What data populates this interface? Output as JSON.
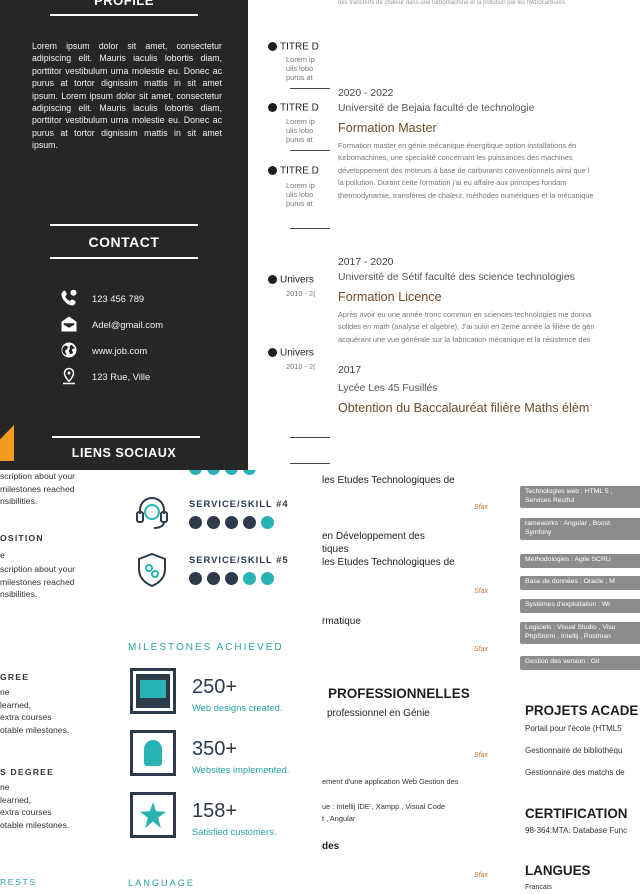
{
  "profile": {
    "heading": "PROFILE",
    "text": "Lorem ipsum dolor sit amet, consectetur adipiscing elit. Mauris iaculis lobortis diam, porttitor vestibulum urna molestie eu. Donec ac purus at tortor dignissim mattis in sit amet ipsum. Lorem ipsum dolor sit amet, consectetur adipiscing elit. Mauris iaculis lobortis diam, porttitor vestibulum urna molestie eu. Donec ac purus at tortor dignissim mattis in sit amet ipsum."
  },
  "contact": {
    "heading": "CONTACT",
    "items": [
      {
        "icon": "phone-icon",
        "text": "123 456 789"
      },
      {
        "icon": "envelope-icon",
        "text": "Adel@gmail.com"
      },
      {
        "icon": "globe-icon",
        "text": "www.job.com"
      },
      {
        "icon": "location-pin-icon",
        "text": "123 Rue, Ville"
      }
    ]
  },
  "social": {
    "heading": "LIENS SOCIAUX"
  },
  "middle": {
    "items": [
      {
        "title": "TITRE D",
        "lines": [
          "Lorem ip",
          "ulis lobo",
          "purus at"
        ]
      },
      {
        "title": "TITRE D",
        "lines": [
          "Lorem ip",
          "ulis lobo",
          "purus at"
        ]
      },
      {
        "title": "TITRE D",
        "lines": [
          "Lorem ip",
          "ulis lobo",
          "purus at"
        ]
      },
      {
        "title": "Univers",
        "lines": [
          "2010 - 2("
        ]
      },
      {
        "title": "Univers",
        "lines": [
          "2010 - 2("
        ]
      }
    ]
  },
  "education": {
    "top_line": "des transferts de chaleur dans une turbomachine et la pollution par les hydrocarbures.",
    "entries": [
      {
        "date": "2020 - 2022",
        "school": "Université de Bejaia faculté de technologie",
        "degree": "Formation Master",
        "desc": "Formation master en génie mécanique énergitique option installations én\nturbomachines, une specialité concernant les puissances des machines\ndéveloppement des moteurs à base de carburants conventionnels ainsi que l\nla pollution. Durant cette formation j'ai eu affaire aux principes fondam\nthermodynamie, transfères de chaleur, méthodes numériques et la mécanique"
      },
      {
        "date": "2017 - 2020",
        "school": "Université de Sétif faculté des science technologies",
        "degree": "Formation Licence",
        "desc": "Après avoir eu une année tronc commun en sciences technologies me donna\nsolides en math (analyse et algèbre), J'ai suivi en 2eme année la filière de gén\nacquérant une vue générale sur la fabrication mécanique et la résistence des"
      },
      {
        "date": "2017",
        "school": "Lycée Les 45 Fusillés",
        "degree": "Obtention du Baccalauréat filière Maths élèm",
        "desc": ""
      }
    ]
  },
  "bottom_left": {
    "block1": "scription about your\nmilestones reached\nnsibilities.",
    "pos_heading": "OSITION",
    "pos_sub": "e",
    "block2": "scription about your\nmilestones reached\nnsibilities.",
    "deg1_heading": "GREE",
    "deg1_lines": "ne\nlearned,\nextra courses\notable milestones.",
    "deg2_heading": "S DEGREE",
    "deg2_lines": "ne\nlearned,\nextra courses\notable milestones.",
    "interests": "RESTS"
  },
  "skills": {
    "items": [
      {
        "label": "SERVICE/SKILL #4",
        "icon": "headset-icon",
        "level": 4
      },
      {
        "label": "SERVICE/SKILL #5",
        "icon": "shield-icon",
        "level": 3
      }
    ],
    "milestones_title": "MILESTONES ACHIEVED",
    "milestones": [
      {
        "icon": "browser-icon",
        "number": "250+",
        "caption": "Web designs created."
      },
      {
        "icon": "touch-icon",
        "number": "350+",
        "caption": "Websites implemented."
      },
      {
        "icon": "star-icon",
        "number": "158+",
        "caption": "Satisfied customers."
      }
    ],
    "language_title": "LANGUAGE",
    "colors": {
      "navy": "#2c3a4a",
      "teal": "#2ab3b3"
    }
  },
  "cv": {
    "lines": [
      {
        "text": "les Etudes Technologiques de",
        "sfax": "Sfax"
      },
      {
        "text": " en Développement des\ntiques\nles Etudes Technologiques de",
        "sfax": "Sfax"
      },
      {
        "text": "rmatique",
        "sfax": "Sfax"
      }
    ],
    "pro_heading": "PROFESSIONNELLES",
    "pro_sub": "professionnel en Génie",
    "pro_sfax": "Sfax",
    "dev_line": "ement d'une application Web Gestion des",
    "tools_line": "ue : Intellij IDE , Xampp , Visual Code\nt , Angular",
    "des_heading": "des",
    "des_sfax": "Sfax",
    "tags": [
      "Technologies web : HTML 5 ,\nServices Restful",
      "rameworks : Angular , Boost\nSymfony",
      "Méthodologies : Agile SCRU",
      "Base de données : Oracle , M",
      "Systèmes d'exploitation : Wi",
      "Logiciels : Visual Studio , Visu\nPhpStorm , Intellij , Postman",
      "Gestion des version : Git"
    ],
    "projects_heading": "PROJETS ACADE",
    "projects": [
      "Portail pour l'école (HTML5",
      "Gestionnaire de bibliothèqu",
      "Gestionnaire des matchs de"
    ],
    "cert_heading": "CERTIFICATION",
    "cert_line": "98-364:MTA: Database Func",
    "lang_heading": "LANGUES",
    "lang_line": "Francais"
  }
}
